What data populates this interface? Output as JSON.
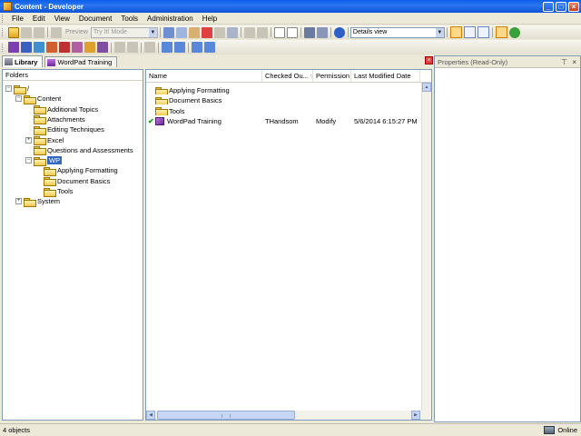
{
  "window": {
    "title": "Content - Developer"
  },
  "menu": {
    "items": [
      {
        "label": "File",
        "key": "F"
      },
      {
        "label": "Edit",
        "key": "E"
      },
      {
        "label": "View",
        "key": "V"
      },
      {
        "label": "Document",
        "key": "D"
      },
      {
        "label": "Tools",
        "key": "T"
      },
      {
        "label": "Administration",
        "key": "A"
      },
      {
        "label": "Help",
        "key": "H"
      }
    ]
  },
  "toolbar": {
    "preview_label": "Preview",
    "mode_value": "Try It! Mode",
    "view_value": "Details view"
  },
  "tabs": [
    {
      "label": "Library",
      "active": true
    },
    {
      "label": "WordPad Training",
      "active": false
    }
  ],
  "folders": {
    "header": "Folders",
    "tree": [
      {
        "label": "/",
        "depth": 0,
        "expander": "−"
      },
      {
        "label": "Content",
        "depth": 1,
        "expander": "−"
      },
      {
        "label": "Additional Topics",
        "depth": 2,
        "expander": ""
      },
      {
        "label": "Attachments",
        "depth": 2,
        "expander": ""
      },
      {
        "label": "Editing Techniques",
        "depth": 2,
        "expander": ""
      },
      {
        "label": "Excel",
        "depth": 2,
        "expander": "+"
      },
      {
        "label": "Questions and Assessments",
        "depth": 2,
        "expander": ""
      },
      {
        "label": "WP",
        "depth": 2,
        "expander": "−",
        "selected": true
      },
      {
        "label": "Applying Formatting",
        "depth": 3,
        "expander": ""
      },
      {
        "label": "Document Basics",
        "depth": 3,
        "expander": ""
      },
      {
        "label": "Tools",
        "depth": 3,
        "expander": ""
      },
      {
        "label": "System",
        "depth": 1,
        "expander": "+"
      }
    ]
  },
  "list": {
    "columns": [
      "Name",
      "Checked Ou...",
      "Permission",
      "Last Modified Date"
    ],
    "rows": [
      {
        "type": "folder",
        "name": "Applying Formatting",
        "checked_out": "",
        "permission": "",
        "modified": ""
      },
      {
        "type": "folder",
        "name": "Document Basics",
        "checked_out": "",
        "permission": "",
        "modified": ""
      },
      {
        "type": "folder",
        "name": "Tools",
        "checked_out": "",
        "permission": "",
        "modified": ""
      },
      {
        "type": "document",
        "name": "WordPad Training",
        "checked_out": "THandsom",
        "permission": "Modify",
        "modified": "5/6/2014 6:15:27 PM"
      }
    ]
  },
  "properties": {
    "title": "Properties (Read-Only)",
    "pin": "⊤",
    "close": "×"
  },
  "status": {
    "left": "4 objects",
    "right": "Online"
  },
  "colors": {
    "title_bar": "#0a5ee8",
    "selection": "#316ac5",
    "check": "#1a9a1a"
  }
}
